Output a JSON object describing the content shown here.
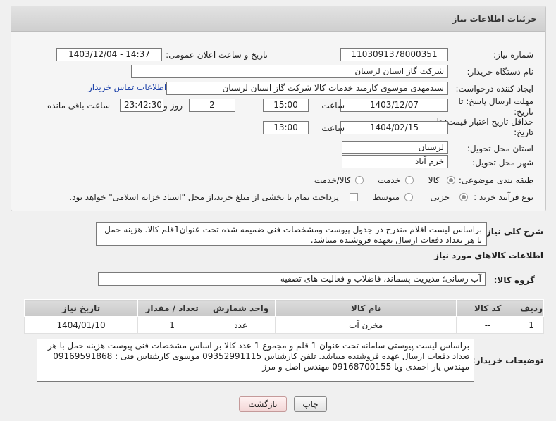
{
  "header": {
    "title": "جزئیات اطلاعات نیاز"
  },
  "need_number": {
    "label": "شماره نیاز:",
    "value": "1103091378000351"
  },
  "announce_datetime": {
    "label": "تاریخ و ساعت اعلان عمومی:",
    "value": "1403/12/04 - 14:37"
  },
  "buyer_org": {
    "label": "نام دستگاه خریدار:",
    "value": "شرکت گاز استان لرستان"
  },
  "requester": {
    "label": "ایجاد کننده درخواست:",
    "value": "سیدمهدی موسوی کارمند خدمات کالا شرکت گاز استان لرستان",
    "contact_link": "اطلاعات تماس خریدار"
  },
  "reply_deadline": {
    "label_line1": "مهلت ارسال پاسخ: تا",
    "label_line2": "تاریخ:",
    "date": "1403/12/07",
    "time_label": "ساعت",
    "time": "15:00",
    "days": "2",
    "days_label": "روز و",
    "remaining": "23:42:30",
    "remaining_label": "ساعت باقی مانده"
  },
  "price_validity": {
    "label_line1": "حداقل تاریخ اعتبار قیمت: تا",
    "label_line2": "تاریخ:",
    "date": "1404/02/15",
    "time_label": "ساعت",
    "time": "13:00"
  },
  "delivery_province": {
    "label": "استان محل تحویل:",
    "value": "لرستان"
  },
  "delivery_city": {
    "label": "شهر محل تحویل:",
    "value": "خرم آباد"
  },
  "category": {
    "label": "طبقه بندی موضوعی:",
    "options": [
      "کالا",
      "خدمت",
      "کالا/خدمت"
    ]
  },
  "purchase_process": {
    "label": "نوع فرآیند خرید :",
    "options": [
      "جزیی",
      "متوسط"
    ],
    "payment_note": "پرداخت تمام یا بخشی از مبلغ خرید،از محل \"اسناد خزانه اسلامی\" خواهد بود."
  },
  "general_description": {
    "label": "شرح کلی نیاز:",
    "value": "براساس لیست اقلام مندرج در جدول پیوست ومشخصات فنی ضمیمه شده تحت عنوان1قلم کالا. هزینه حمل با هر تعداد دفعات ارسال بعهده فروشنده میباشد."
  },
  "goods_info_title": "اطلاعات کالاهای مورد نیاز",
  "goods_group": {
    "label": "گروه کالا:",
    "value": "آب رسانی؛ مدیریت پسماند، فاضلاب و فعالیت های تصفیه"
  },
  "table": {
    "headers": [
      "ردیف",
      "کد کالا",
      "نام کالا",
      "واحد شمارش",
      "تعداد / مقدار",
      "تاریخ نیاز"
    ],
    "rows": [
      [
        "1",
        "--",
        "مخزن آب",
        "عدد",
        "1",
        "1404/01/10"
      ]
    ]
  },
  "buyer_notes": {
    "label": "توضیحات خریدار:",
    "value": "براساس  لیست پیوستی سامانه تحت عنوان 1 قلم و مجموع 1 عدد کالا بر اساس مشخصات فنی پیوست هزینه حمل با هر تعداد دفعات ارسال عهده فروشنده میباشد. تلفن کارشناس  09352991115  موسوی  کارشناس فنی : 09169591868 مهندس یار احمدی ویا 09168700155 مهندس اصل و مرز"
  },
  "buttons": {
    "print": "چاپ",
    "back": "بازگشت"
  }
}
